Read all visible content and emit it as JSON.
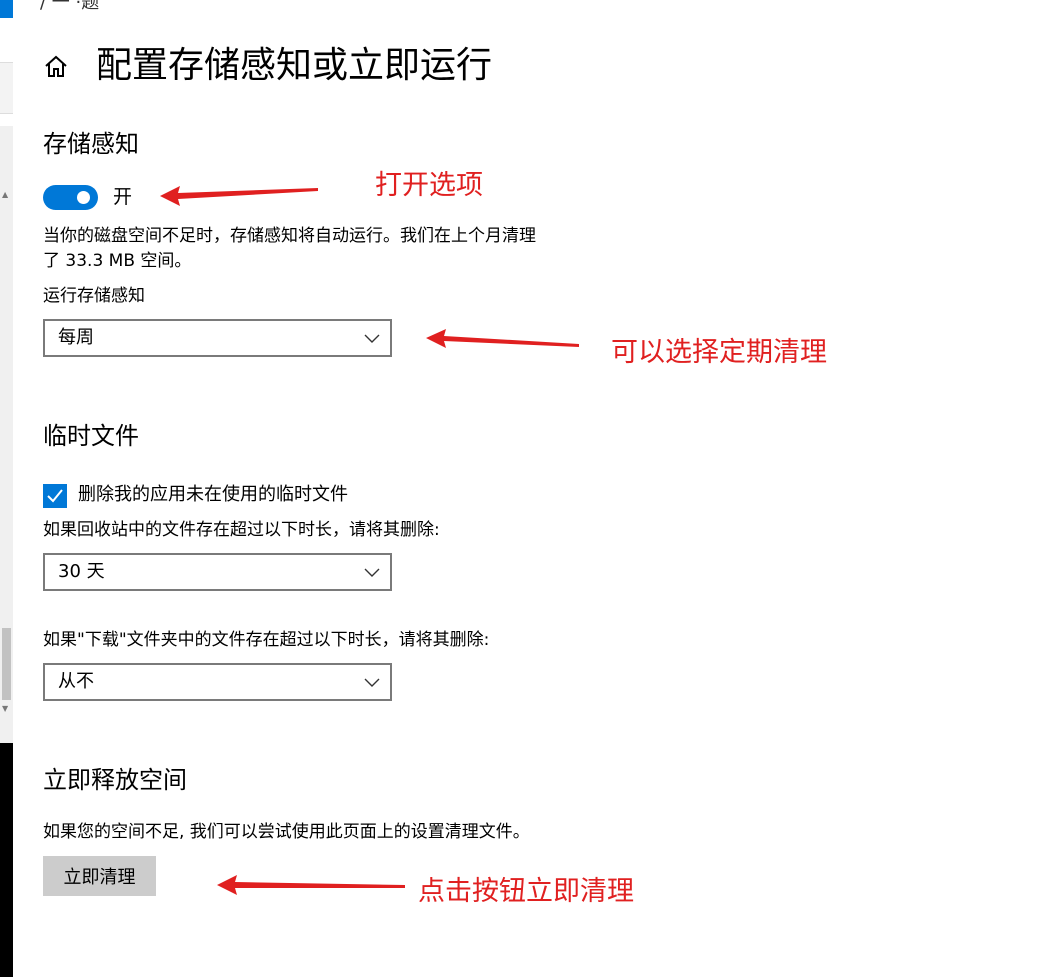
{
  "header": {
    "title": "配置存储感知或立即运行",
    "top_fragment": "/ 一 ·题"
  },
  "storage_sense": {
    "heading": "存储感知",
    "toggle_label": "开",
    "desc_line1": "当你的磁盘空间不足时，存储感知将自动运行。我们在上个月清理",
    "desc_line2": "了 33.3 MB 空间。",
    "run_label": "运行存储感知",
    "run_value": "每周",
    "toggle_on": true
  },
  "temp_files": {
    "heading": "临时文件",
    "checkbox_label": "删除我的应用未在使用的临时文件",
    "checked": true,
    "recycle_label": "如果回收站中的文件存在超过以下时长，请将其删除:",
    "recycle_value": "30 天",
    "downloads_label": "如果\"下载\"文件夹中的文件存在超过以下时长，请将其删除:",
    "downloads_value": "从不"
  },
  "free_now": {
    "heading": "立即释放空间",
    "desc": "如果您的空间不足, 我们可以尝试使用此页面上的设置清理文件。",
    "button_label": "立即清理"
  },
  "annotations": {
    "a1": "打开选项",
    "a2": "可以选择定期清理",
    "a3": "点击按钮立即清理"
  },
  "colors": {
    "accent": "#0078d7",
    "annotation": "#e02020",
    "button_bg": "#cccccc"
  },
  "icons": [
    "home-icon",
    "chevron-down-icon",
    "checkmark-icon",
    "arrow-left-icon"
  ]
}
